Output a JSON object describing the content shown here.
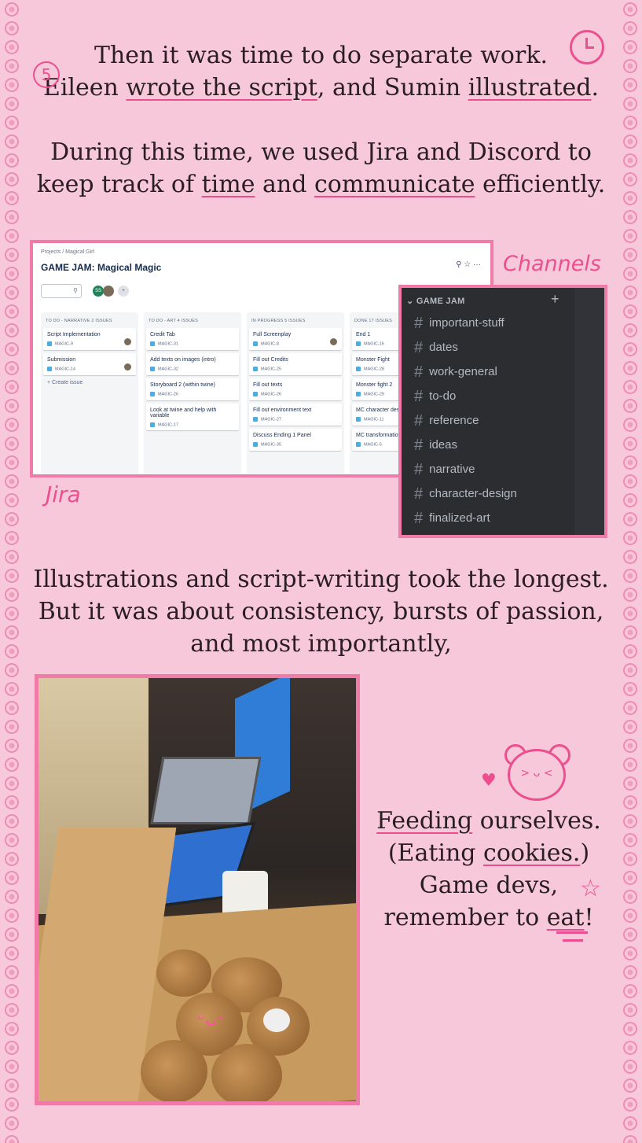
{
  "intro": {
    "line1": "Then it was time to do separate work.",
    "line2_a": "Eileen ",
    "line2_b": "wrote the script",
    "line2_c": ", and Sumin ",
    "line2_d": "illustrated",
    "line2_e": ".",
    "step_number": "5"
  },
  "tools_text": {
    "a": "During this time, we used Jira and Discord to keep track of ",
    "b": "time",
    "c": " and ",
    "d": "communicate",
    "e": " efficiently."
  },
  "jira": {
    "label": "Jira",
    "breadcrumb": "Projects  /  Magical Girl",
    "title": "GAME JAM: Magical Magic",
    "columns": [
      {
        "header": "TO DO - NARRATIVE 2 ISSUES",
        "cards": [
          {
            "title": "Script Implementation",
            "key": "MAGIC-9"
          },
          {
            "title": "Submission",
            "key": "MAGIC-14"
          }
        ],
        "create": "+ Create issue"
      },
      {
        "header": "TO DO - ART 4 ISSUES",
        "cards": [
          {
            "title": "Credit Tab",
            "key": "MAGIC-31"
          },
          {
            "title": "Add texts on images (intro)",
            "key": "MAGIC-32"
          },
          {
            "title": "Storyboard 2 (within twine)",
            "key": "MAGIC-26"
          },
          {
            "title": "Look at twine and help with variable",
            "key": "MAGIC-17"
          }
        ]
      },
      {
        "header": "IN PROGRESS 5 ISSUES",
        "cards": [
          {
            "title": "Full Screenplay",
            "key": "MAGIC-8"
          },
          {
            "title": "Fill out Credits",
            "key": "MAGIC-25"
          },
          {
            "title": "Fill out texts",
            "key": "MAGIC-26"
          },
          {
            "title": "Fill out environment text",
            "key": "MAGIC-27"
          },
          {
            "title": "Discuss Ending 1 Panel",
            "key": "MAGIC-35"
          }
        ]
      },
      {
        "header": "DONE 17 ISSUES",
        "cards": [
          {
            "title": "End 1",
            "key": "MAGIC-16"
          },
          {
            "title": "Monster Fight",
            "key": "MAGIC-28"
          },
          {
            "title": "Monster fight 2",
            "key": "MAGIC-29"
          },
          {
            "title": "MC character design",
            "key": "MAGIC-11"
          },
          {
            "title": "MC transformation",
            "key": "MAGIC-5"
          }
        ]
      }
    ]
  },
  "discord": {
    "label": "Channels",
    "category": "GAME JAM",
    "channels": [
      "important-stuff",
      "dates",
      "work-general",
      "to-do",
      "reference",
      "ideas",
      "narrative",
      "character-design",
      "finalized-art"
    ]
  },
  "middle_text": {
    "line1": "Illustrations and script-writing took the longest.",
    "line2": "But it was about consistency, bursts of passion,",
    "line3": "and most importantly,"
  },
  "feed_text": {
    "a": "Feeding",
    "b": " ourselves.",
    "c": "(Eating ",
    "d": "cookies.",
    "e": ")",
    "f": "Game devs,",
    "g": "remember to ",
    "h": "eat",
    "i": "!"
  },
  "colors": {
    "background": "#f7c8d9",
    "accent": "#f07ba8",
    "underline": "#e84f8c"
  }
}
